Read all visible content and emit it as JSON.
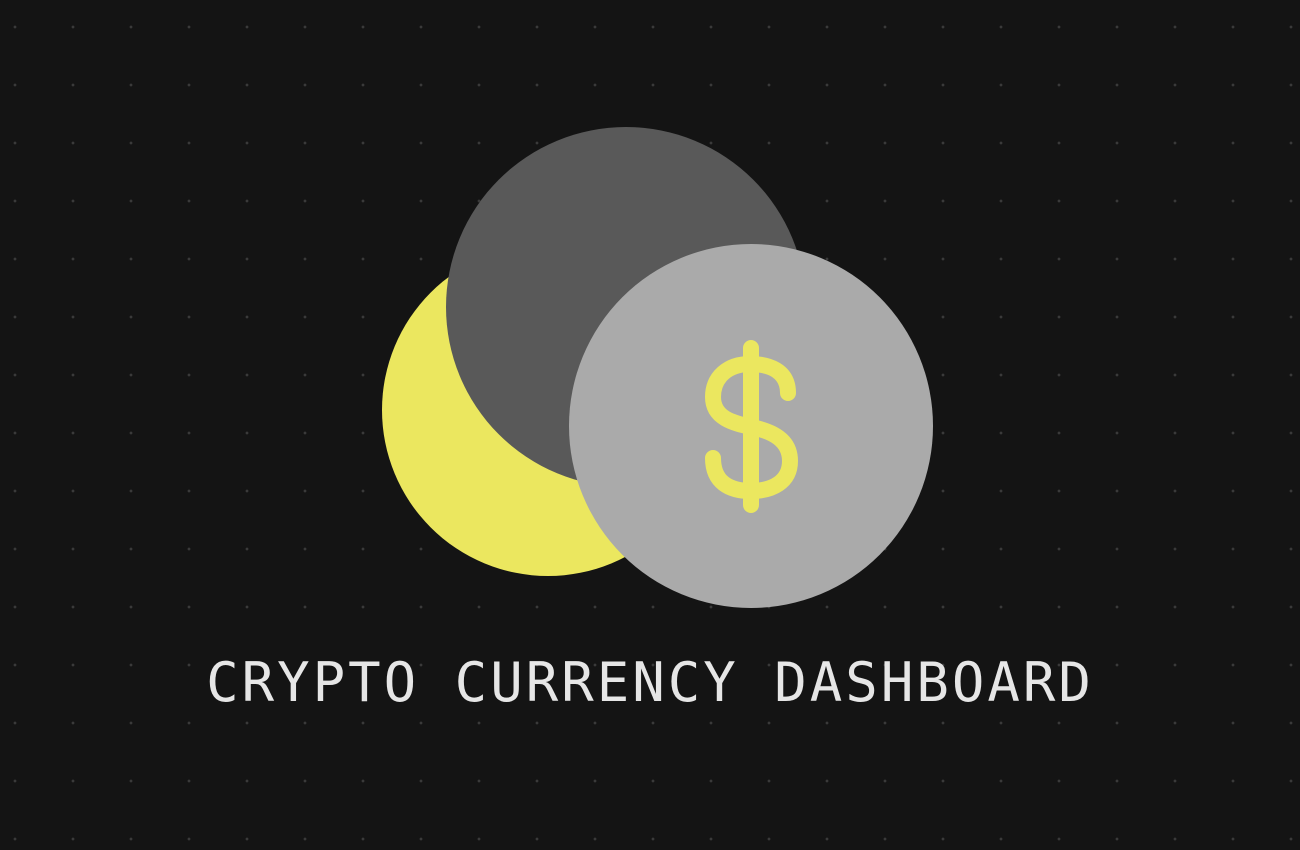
{
  "title": "CRYPTO CURRENCY DASHBOARD",
  "icons": [
    "yellow-coin-icon",
    "dark-coin-icon",
    "dollar-coin-icon",
    "dollar-sign-icon"
  ],
  "colors": {
    "background": "#141414",
    "dots": "#3a3a3a",
    "coin_yellow": "#ebe75f",
    "coin_dark": "#595959",
    "coin_light": "#aaaaaa",
    "dollar_sign": "#ebe75f",
    "title_text": "#e6e6e6"
  }
}
